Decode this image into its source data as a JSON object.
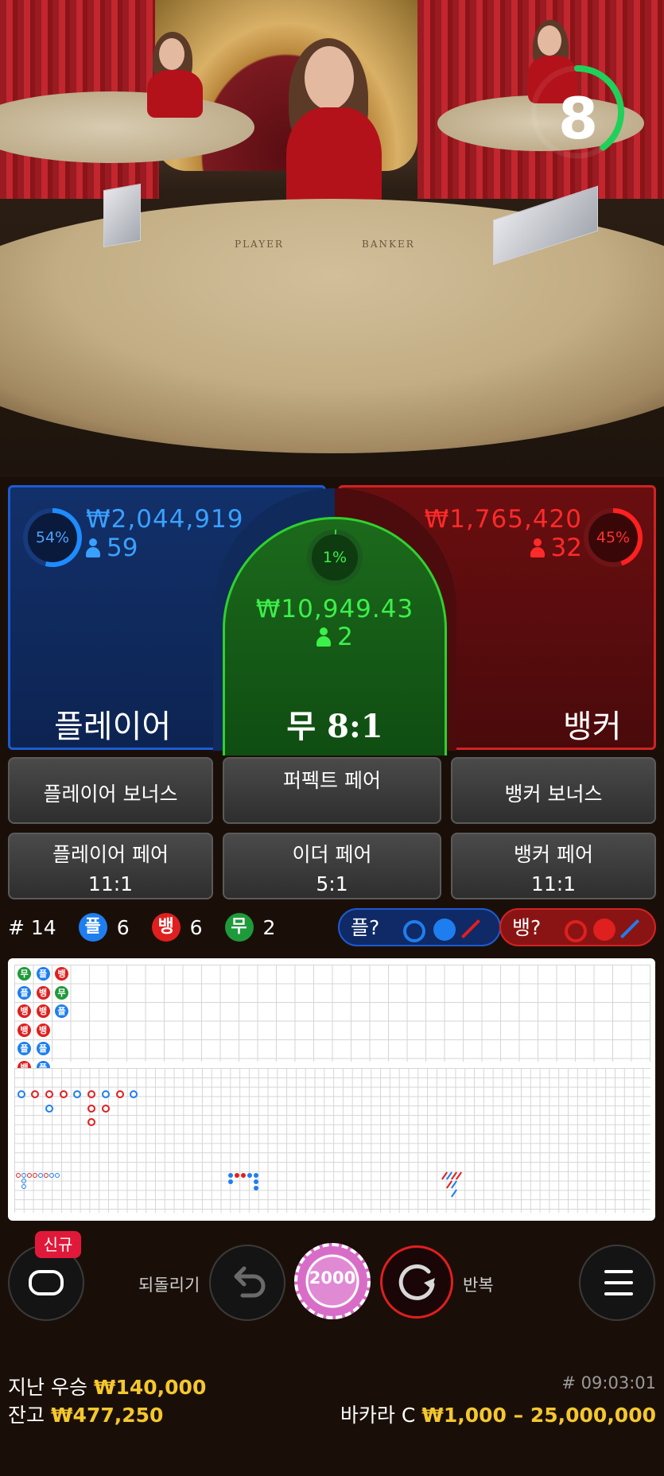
{
  "video": {
    "table_player_text": "PLAYER",
    "table_banker_text": "BANKER",
    "countdown": "8",
    "countdown_fraction": 0.4
  },
  "bets": {
    "player": {
      "percent": "54%",
      "percent_value": 0.54,
      "amount": "₩2,044,919",
      "players": "59",
      "label": "플레이어",
      "color": "#1e8cff"
    },
    "tie": {
      "percent": "1%",
      "percent_value": 0.01,
      "amount": "₩10,949.43",
      "players": "2",
      "label": "무 8:1",
      "color": "#2fe03a"
    },
    "banker": {
      "percent": "45%",
      "percent_value": 0.45,
      "amount": "₩1,765,420",
      "players": "32",
      "label": "뱅커",
      "color": "#ff2020"
    }
  },
  "side_bets": {
    "player_bonus": "플레이어 보너스",
    "perfect_pair": "퍼펙트 페어",
    "banker_bonus": "뱅커 보너스",
    "player_pair": "플레이어 페어",
    "player_pair_odds": "11:1",
    "either_pair": "이더 페어",
    "either_pair_odds": "5:1",
    "banker_pair": "뱅커 페어",
    "banker_pair_odds": "11:1"
  },
  "stats": {
    "round": "# 14",
    "player_glyph": "플",
    "player_count": "6",
    "banker_glyph": "뱅",
    "banker_count": "6",
    "tie_glyph": "무",
    "tie_count": "2",
    "player_predict": "플?",
    "banker_predict": "뱅?"
  },
  "roadmap": {
    "bead_plate": [
      [
        "무",
        "플",
        "뱅",
        "뱅",
        "플",
        "뱅"
      ],
      [
        "플",
        "뱅",
        "뱅",
        "뱅",
        "플",
        "플"
      ],
      [
        "뱅",
        "무",
        "플"
      ]
    ]
  },
  "controls": {
    "new_badge": "신규",
    "undo_label": "되돌리기",
    "chip_value": "2000",
    "repeat_label": "반복"
  },
  "footer": {
    "last_win_label": "지난 우승",
    "last_win_value": "₩140,000",
    "balance_label": "잔고",
    "balance_value": "₩477,250",
    "game_id": "# 09:03:01",
    "table_name": "바카라 C",
    "limits": "₩1,000 – 25,000,000"
  },
  "colors": {
    "player": "#1e8cff",
    "banker": "#e01f1f",
    "tie": "#1f9a3a",
    "gold": "#f4c72e"
  }
}
